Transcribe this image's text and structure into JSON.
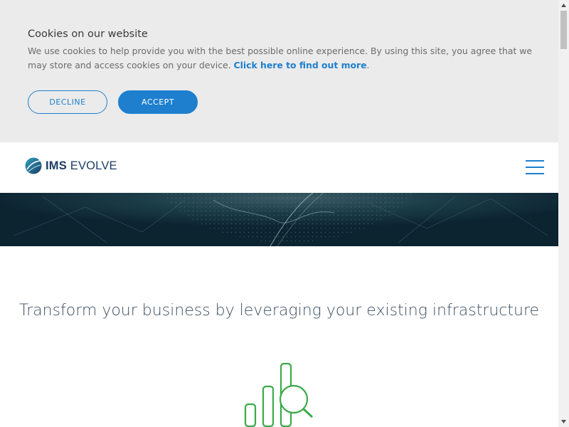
{
  "cookie_banner": {
    "title": "Cookies on our website",
    "text": "We use cookies to help provide you with the best possible online experience. By using this site, you agree that we may store and access cookies on your device.",
    "link": "Click here to find out more",
    "decline_label": "DECLINE",
    "accept_label": "ACCEPT"
  },
  "header": {
    "logo_bold": "IMS",
    "logo_light": "EVOLVE",
    "menu_icon": "hamburger-menu-icon"
  },
  "hero": {
    "image": "globe-network-banner"
  },
  "main": {
    "headline": "Transform your business by leveraging your existing infrastructure",
    "feature_icon": "bar-chart-magnifier-icon"
  },
  "colors": {
    "accent": "#1e7fce",
    "banner_bg": "#ebebeb",
    "icon_green": "#3aaa4a",
    "logo_navy": "#1c3c62",
    "hero_bg": "#0f2a37"
  }
}
